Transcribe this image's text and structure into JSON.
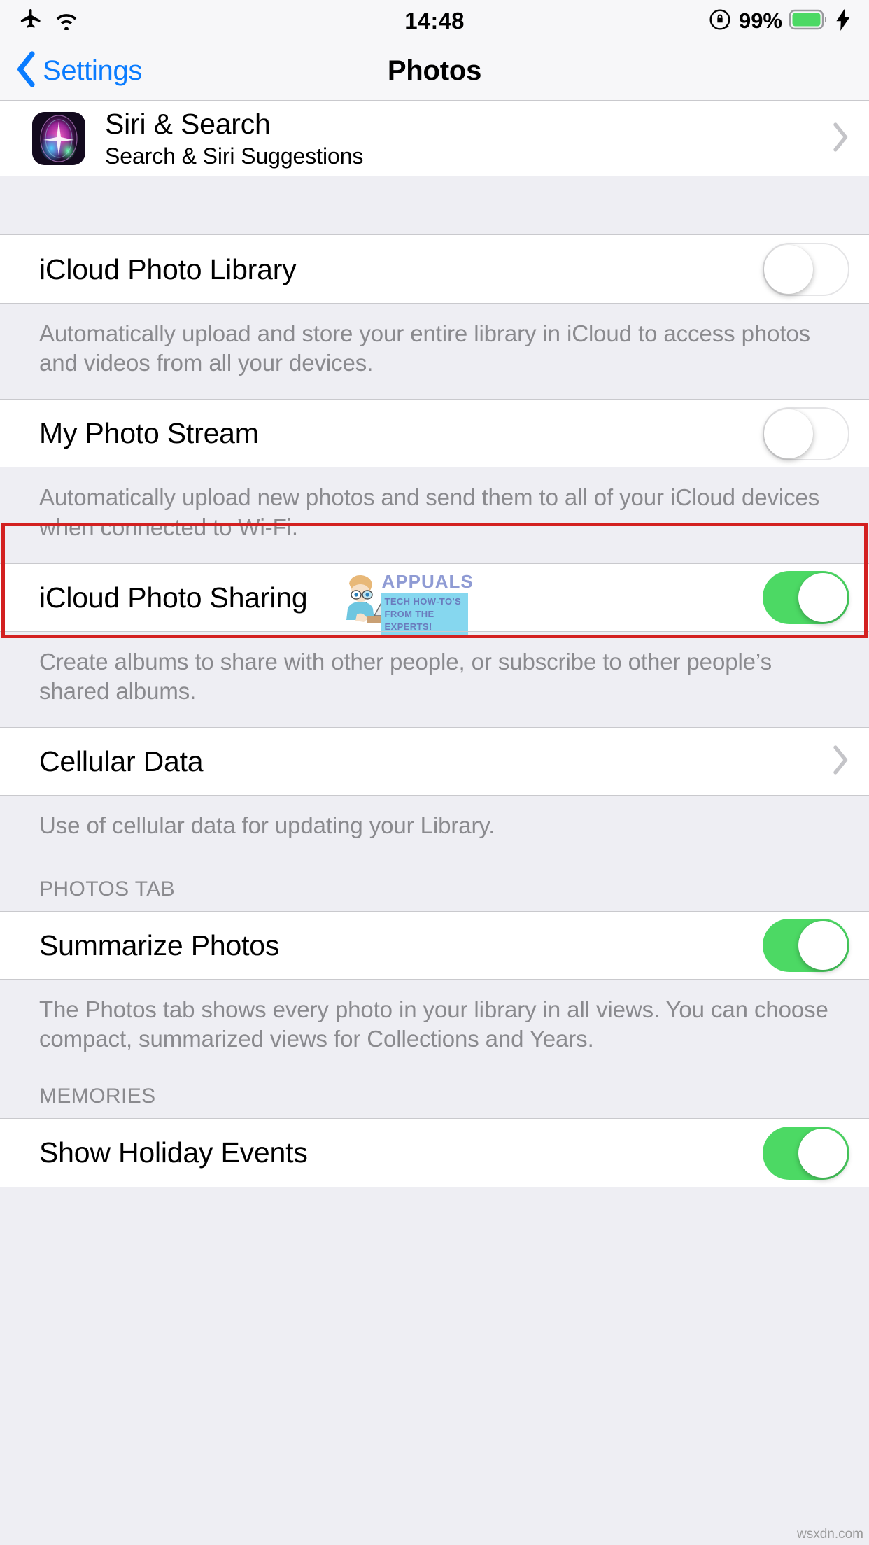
{
  "status_bar": {
    "airplane_icon": "airplane-mode-icon",
    "wifi_icon": "wifi-icon",
    "time": "14:48",
    "rotation_lock_icon": "rotation-lock-icon",
    "battery_percent": "99%",
    "battery_icon": "battery-full-icon",
    "charging_icon": "lightning-bolt-icon",
    "battery_color": "#4cd964"
  },
  "nav": {
    "back_label": "Settings",
    "back_icon": "chevron-left-icon",
    "title": "Photos",
    "tint_color": "#0a7cff"
  },
  "sections": {
    "siri": {
      "title": "Siri & Search",
      "subtitle": "Search & Siri Suggestions",
      "icon": "siri-app-icon",
      "chevron": "chevron-right-icon"
    },
    "icloud_photo_library": {
      "title": "iCloud Photo Library",
      "toggle_state": "off",
      "footer": "Automatically upload and store your entire library in iCloud to access photos and videos from all your devices."
    },
    "my_photo_stream": {
      "title": "My Photo Stream",
      "toggle_state": "off",
      "footer": "Automatically upload new photos and send them to all of your iCloud devices when connected to Wi-Fi.",
      "highlighted": true,
      "highlight_color": "#d32020"
    },
    "icloud_photo_sharing": {
      "title": "iCloud Photo Sharing",
      "toggle_state": "on",
      "footer": "Create albums to share with other people, or subscribe to other people’s shared albums."
    },
    "cellular_data": {
      "title": "Cellular Data",
      "chevron": "chevron-right-icon",
      "footer": "Use of cellular data for updating your Library."
    },
    "photos_tab": {
      "header": "PHOTOS TAB",
      "summarize_photos": {
        "title": "Summarize Photos",
        "toggle_state": "on"
      },
      "footer": "The Photos tab shows every photo in your library in all views. You can choose compact, summarized views for Collections and Years."
    },
    "memories": {
      "header": "MEMORIES",
      "show_holiday_events": {
        "title": "Show Holiday Events",
        "toggle_state": "on"
      }
    }
  },
  "watermarks": {
    "appuals_name": "APPUALS",
    "appuals_tagline": "TECH HOW-TO'S FROM THE EXPERTS!",
    "corner": "wsxdn.com"
  },
  "colors": {
    "toggle_on": "#4cd964",
    "group_bg": "#eeeef3",
    "cell_bg": "#ffffff",
    "separator": "#c9c9cd",
    "secondary_text": "#8a8a8e"
  }
}
